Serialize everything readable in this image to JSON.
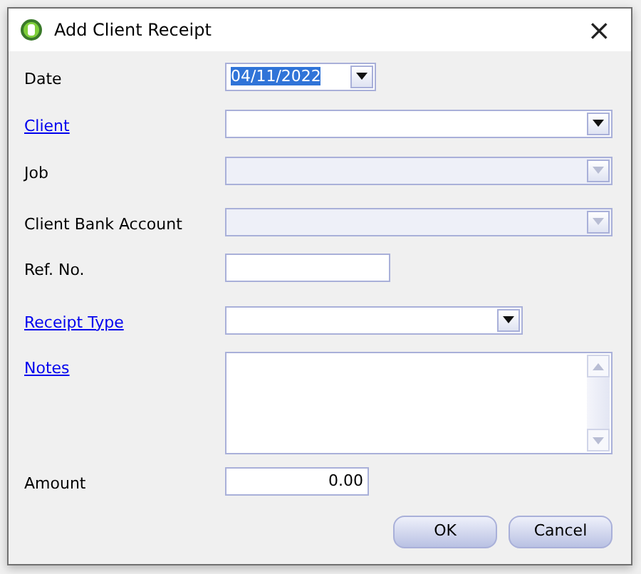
{
  "window": {
    "title": "Add Client Receipt",
    "close": "×"
  },
  "fields": [
    {
      "label": "Date",
      "link": false,
      "kind": "date",
      "value": "04/11/2022",
      "selected": true,
      "disabled": false
    },
    {
      "label": "Client",
      "link": true,
      "kind": "combo",
      "disabled": false
    },
    {
      "label": "Job",
      "link": false,
      "kind": "combo",
      "disabled": true
    },
    {
      "label": "Client Bank Account",
      "link": false,
      "kind": "combo",
      "disabled": true
    },
    {
      "label": "Ref. No.",
      "link": false,
      "kind": "text",
      "disabled": false
    },
    {
      "label": "Receipt Type",
      "link": true,
      "kind": "combo-mid",
      "disabled": false
    },
    {
      "label": "Notes",
      "link": true,
      "kind": "memo",
      "disabled": false
    },
    {
      "label": "Amount",
      "link": false,
      "kind": "number",
      "value": "0.00",
      "disabled": false
    }
  ],
  "buttons": [
    "OK",
    "Cancel"
  ]
}
